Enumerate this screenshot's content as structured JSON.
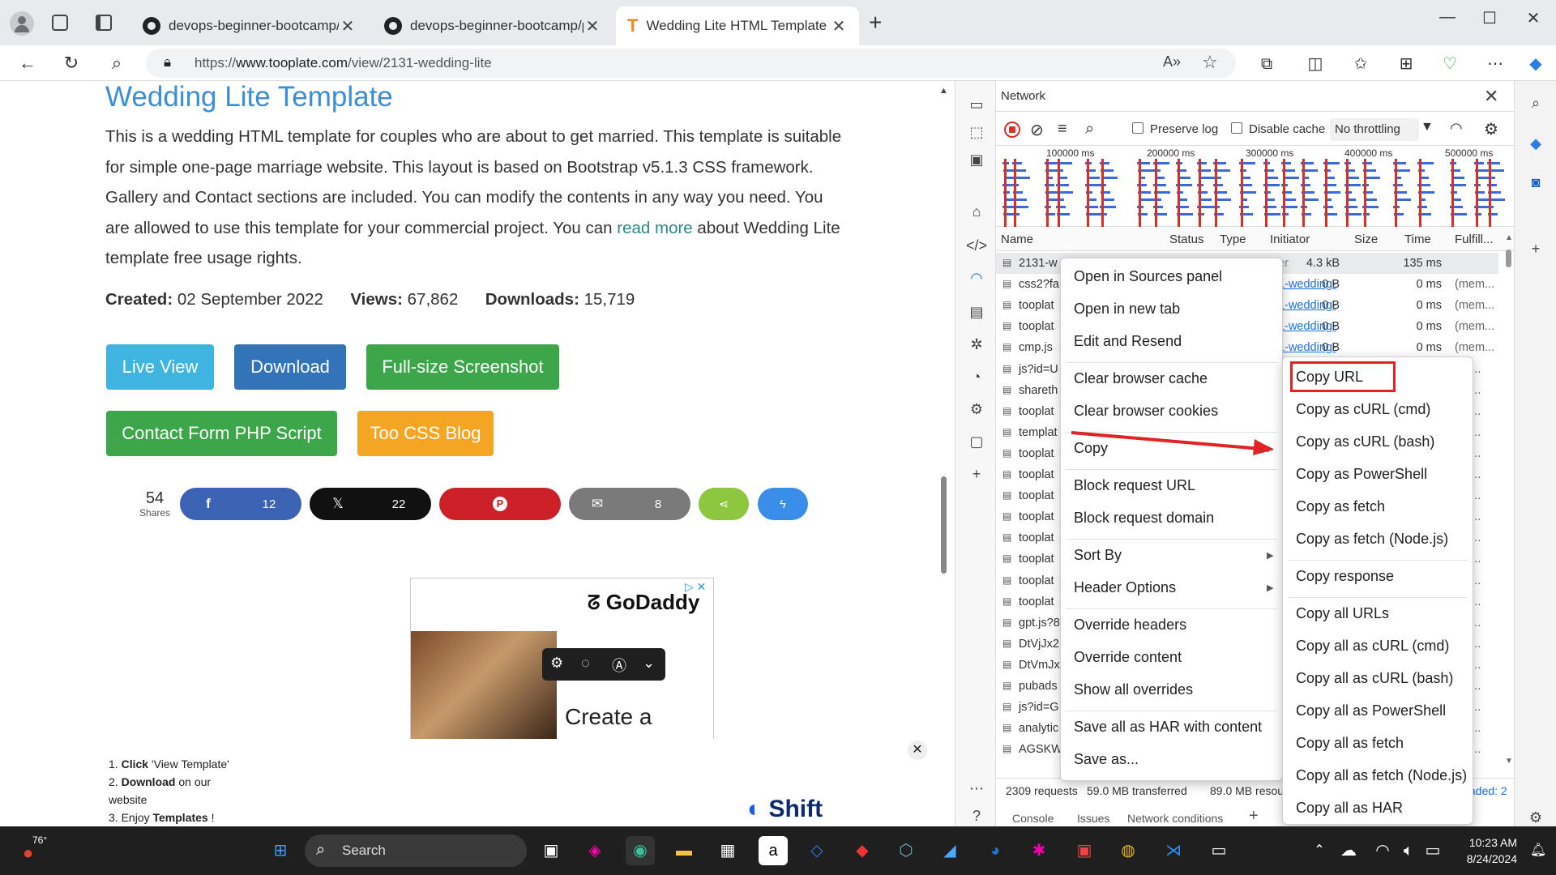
{
  "browser": {
    "tabs": [
      {
        "title": "devops-beginner-bootcamp/proj",
        "active": false
      },
      {
        "title": "devops-beginner-bootcamp/proj",
        "active": false
      },
      {
        "title": "Wedding Lite HTML Template by",
        "active": true
      }
    ],
    "url_prefix": "https://",
    "url_domain": "www.tooplate.com",
    "url_path": "/view/2131-wedding-lite"
  },
  "page": {
    "title": "Wedding Lite Template",
    "description_before_link": "This is a wedding HTML template for couples who are about to get married. This template is suitable for simple one-page marriage website. This layout is based on Bootstrap v5.1.3 CSS framework. Gallery and Contact sections are included. You can modify the contents in any way you need. You are allowed to use this template for your commercial project. You can ",
    "description_link": "read more",
    "description_after_link": " about Wedding Lite template free usage rights.",
    "created_label": "Created:",
    "created_value": "02 September 2022",
    "views_label": "Views:",
    "views_value": "67,862",
    "downloads_label": "Downloads:",
    "downloads_value": "15,719",
    "buttons": {
      "live_view": "Live View",
      "download": "Download",
      "screenshot": "Full-size Screenshot",
      "contact_form": "Contact Form PHP Script",
      "css_blog": "Too CSS Blog"
    },
    "shares": {
      "total": "54",
      "total_label": "Shares",
      "facebook": "12",
      "x": "22",
      "email": "8"
    },
    "ad": {
      "brand": "GoDaddy",
      "headline": "Create a"
    },
    "banner": {
      "step1_bold": "Click",
      "step1_rest": " 'View Template'",
      "step2_bold": "Download",
      "step2_rest": " on our website",
      "step3_pre": "Enjoy ",
      "step3_bold": "Templates",
      "step3_post": " !",
      "brand": "Shift"
    }
  },
  "devtools": {
    "panel_title": "Network",
    "preserve_log": "Preserve log",
    "disable_cache": "Disable cache",
    "throttling": "No throttling",
    "timeline_ticks": [
      "100000 ms",
      "200000 ms",
      "300000 ms",
      "400000 ms",
      "500000 ms"
    ],
    "columns": [
      "Name",
      "Status",
      "Type",
      "Initiator",
      "Size",
      "Time",
      "Fulfill..."
    ],
    "rows": [
      {
        "name": "2131-w",
        "initiator": "ner",
        "size": "4.3 kB",
        "time": "135 ms",
        "fulfill": ""
      },
      {
        "name": "css2?fa",
        "initiator": "31-wedding-",
        "size": "0 B",
        "time": "0 ms",
        "fulfill": "(mem..."
      },
      {
        "name": "tooplat",
        "initiator": "31-wedding-",
        "size": "0 B",
        "time": "0 ms",
        "fulfill": "(mem..."
      },
      {
        "name": "tooplat",
        "initiator": "31-wedding-",
        "size": "0 B",
        "time": "0 ms",
        "fulfill": "(mem..."
      },
      {
        "name": "cmp.js",
        "initiator": "31-wedding-",
        "size": "0 B",
        "time": "0 ms",
        "fulfill": "(mem..."
      },
      {
        "name": "js?id=U",
        "initiator": "",
        "size": "",
        "time": "",
        "fulfill": "em..."
      },
      {
        "name": "shareth",
        "initiator": "",
        "size": "",
        "time": "",
        "fulfill": "em..."
      },
      {
        "name": "tooplat",
        "initiator": "",
        "size": "",
        "time": "",
        "fulfill": "em..."
      },
      {
        "name": "templat",
        "initiator": "",
        "size": "",
        "time": "",
        "fulfill": "em..."
      },
      {
        "name": "tooplat",
        "initiator": "",
        "size": "",
        "time": "",
        "fulfill": "em..."
      },
      {
        "name": "tooplat",
        "initiator": "",
        "size": "",
        "time": "",
        "fulfill": "em..."
      },
      {
        "name": "tooplat",
        "initiator": "",
        "size": "",
        "time": "",
        "fulfill": "em..."
      },
      {
        "name": "tooplat",
        "initiator": "",
        "size": "",
        "time": "",
        "fulfill": "em..."
      },
      {
        "name": "tooplat",
        "initiator": "",
        "size": "",
        "time": "",
        "fulfill": "em..."
      },
      {
        "name": "tooplat",
        "initiator": "",
        "size": "",
        "time": "",
        "fulfill": "em..."
      },
      {
        "name": "tooplat",
        "initiator": "",
        "size": "",
        "time": "",
        "fulfill": "em..."
      },
      {
        "name": "tooplat",
        "initiator": "",
        "size": "",
        "time": "",
        "fulfill": "em..."
      },
      {
        "name": "gpt.js?8",
        "initiator": "",
        "size": "",
        "time": "",
        "fulfill": "em..."
      },
      {
        "name": "DtVjJx2",
        "initiator": "",
        "size": "",
        "time": "",
        "fulfill": "em..."
      },
      {
        "name": "DtVmJx",
        "initiator": "",
        "size": "",
        "time": "",
        "fulfill": "em..."
      },
      {
        "name": "pubads",
        "initiator": "",
        "size": "",
        "time": "",
        "fulfill": "em..."
      },
      {
        "name": "js?id=G",
        "initiator": "",
        "size": "",
        "time": "",
        "fulfill": "em..."
      },
      {
        "name": "analytic",
        "initiator": "",
        "size": "",
        "time": "",
        "fulfill": "em..."
      },
      {
        "name": "AGSKW",
        "initiator": "",
        "size": "",
        "time": "",
        "fulfill": "em..."
      }
    ],
    "status_requests": "2309 requests",
    "status_transferred": "59.0 MB transferred",
    "status_resources": "89.0 MB resour",
    "status_loaded": "aded: 2",
    "drawer_tabs": [
      "Console",
      "Issues",
      "Network conditions"
    ]
  },
  "context_menu": {
    "items": [
      "Open in Sources panel",
      "Open in new tab",
      "Edit and Resend",
      "Clear browser cache",
      "Clear browser cookies",
      "Copy",
      "Block request URL",
      "Block request domain",
      "Sort By",
      "Header Options",
      "Override headers",
      "Override content",
      "Show all overrides",
      "Save all as HAR with content",
      "Save as..."
    ]
  },
  "copy_submenu": {
    "items": [
      "Copy URL",
      "Copy as cURL (cmd)",
      "Copy as cURL (bash)",
      "Copy as PowerShell",
      "Copy as fetch",
      "Copy as fetch (Node.js)",
      "Copy response",
      "Copy all URLs",
      "Copy all as cURL (cmd)",
      "Copy all as cURL (bash)",
      "Copy all as PowerShell",
      "Copy all as fetch",
      "Copy all as fetch (Node.js)",
      "Copy all as HAR"
    ],
    "highlight_color": "#e02424"
  },
  "taskbar": {
    "weather": "76°",
    "search_placeholder": "Search",
    "time": "10:23 AM",
    "date": "8/24/2024"
  },
  "colors": {
    "link_blue": "#3a8fd6",
    "btn_live": "#3fb4e0",
    "btn_download": "#3373b8",
    "btn_green": "#3ea64a",
    "btn_orange": "#f5a524",
    "annotation_red": "#e02424"
  }
}
